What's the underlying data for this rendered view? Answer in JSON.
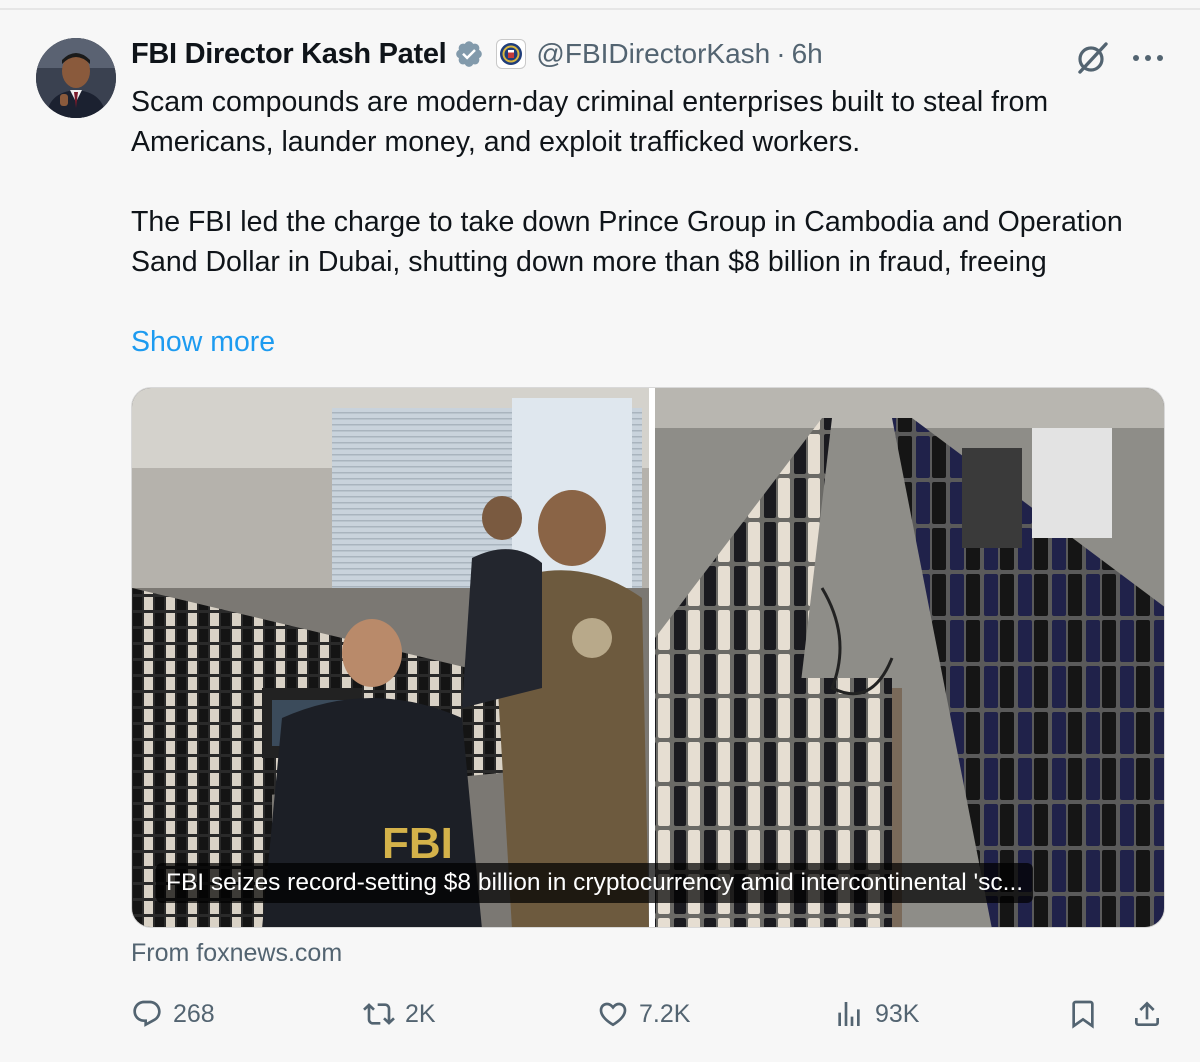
{
  "post": {
    "author": {
      "display_name": "FBI Director Kash Patel",
      "handle": "@FBIDirectorKash",
      "verified": true,
      "affiliate_badge_icon": "fbi-seal-icon"
    },
    "separator": "·",
    "time_ago": "6h",
    "text_paragraphs": [
      "Scam compounds are modern-day criminal enterprises built to steal from Americans, launder money, and exploit trafficked workers.",
      "The FBI led the charge to take down Prince Group in Cambodia and Operation Sand Dollar in Dubai, shutting down more than $8 billion in fraud, freeing"
    ],
    "show_more_label": "Show more",
    "link_card": {
      "caption": "FBI seizes record-setting $8 billion in cryptocurrency amid intercontinental 'sc...",
      "source": "From foxnews.com"
    },
    "metrics": {
      "replies": "268",
      "reposts": "2K",
      "likes": "7.2K",
      "views": "93K"
    }
  },
  "colors": {
    "text": "#0f1419",
    "secondary_text": "#536471",
    "link": "#1d9bf0",
    "verified": "#829aab"
  },
  "icons": {
    "reply": "reply-icon",
    "repost": "repost-icon",
    "like": "like-icon",
    "views": "views-icon",
    "bookmark": "bookmark-icon",
    "share": "share-icon",
    "grok": "grok-icon",
    "more": "more-icon"
  }
}
